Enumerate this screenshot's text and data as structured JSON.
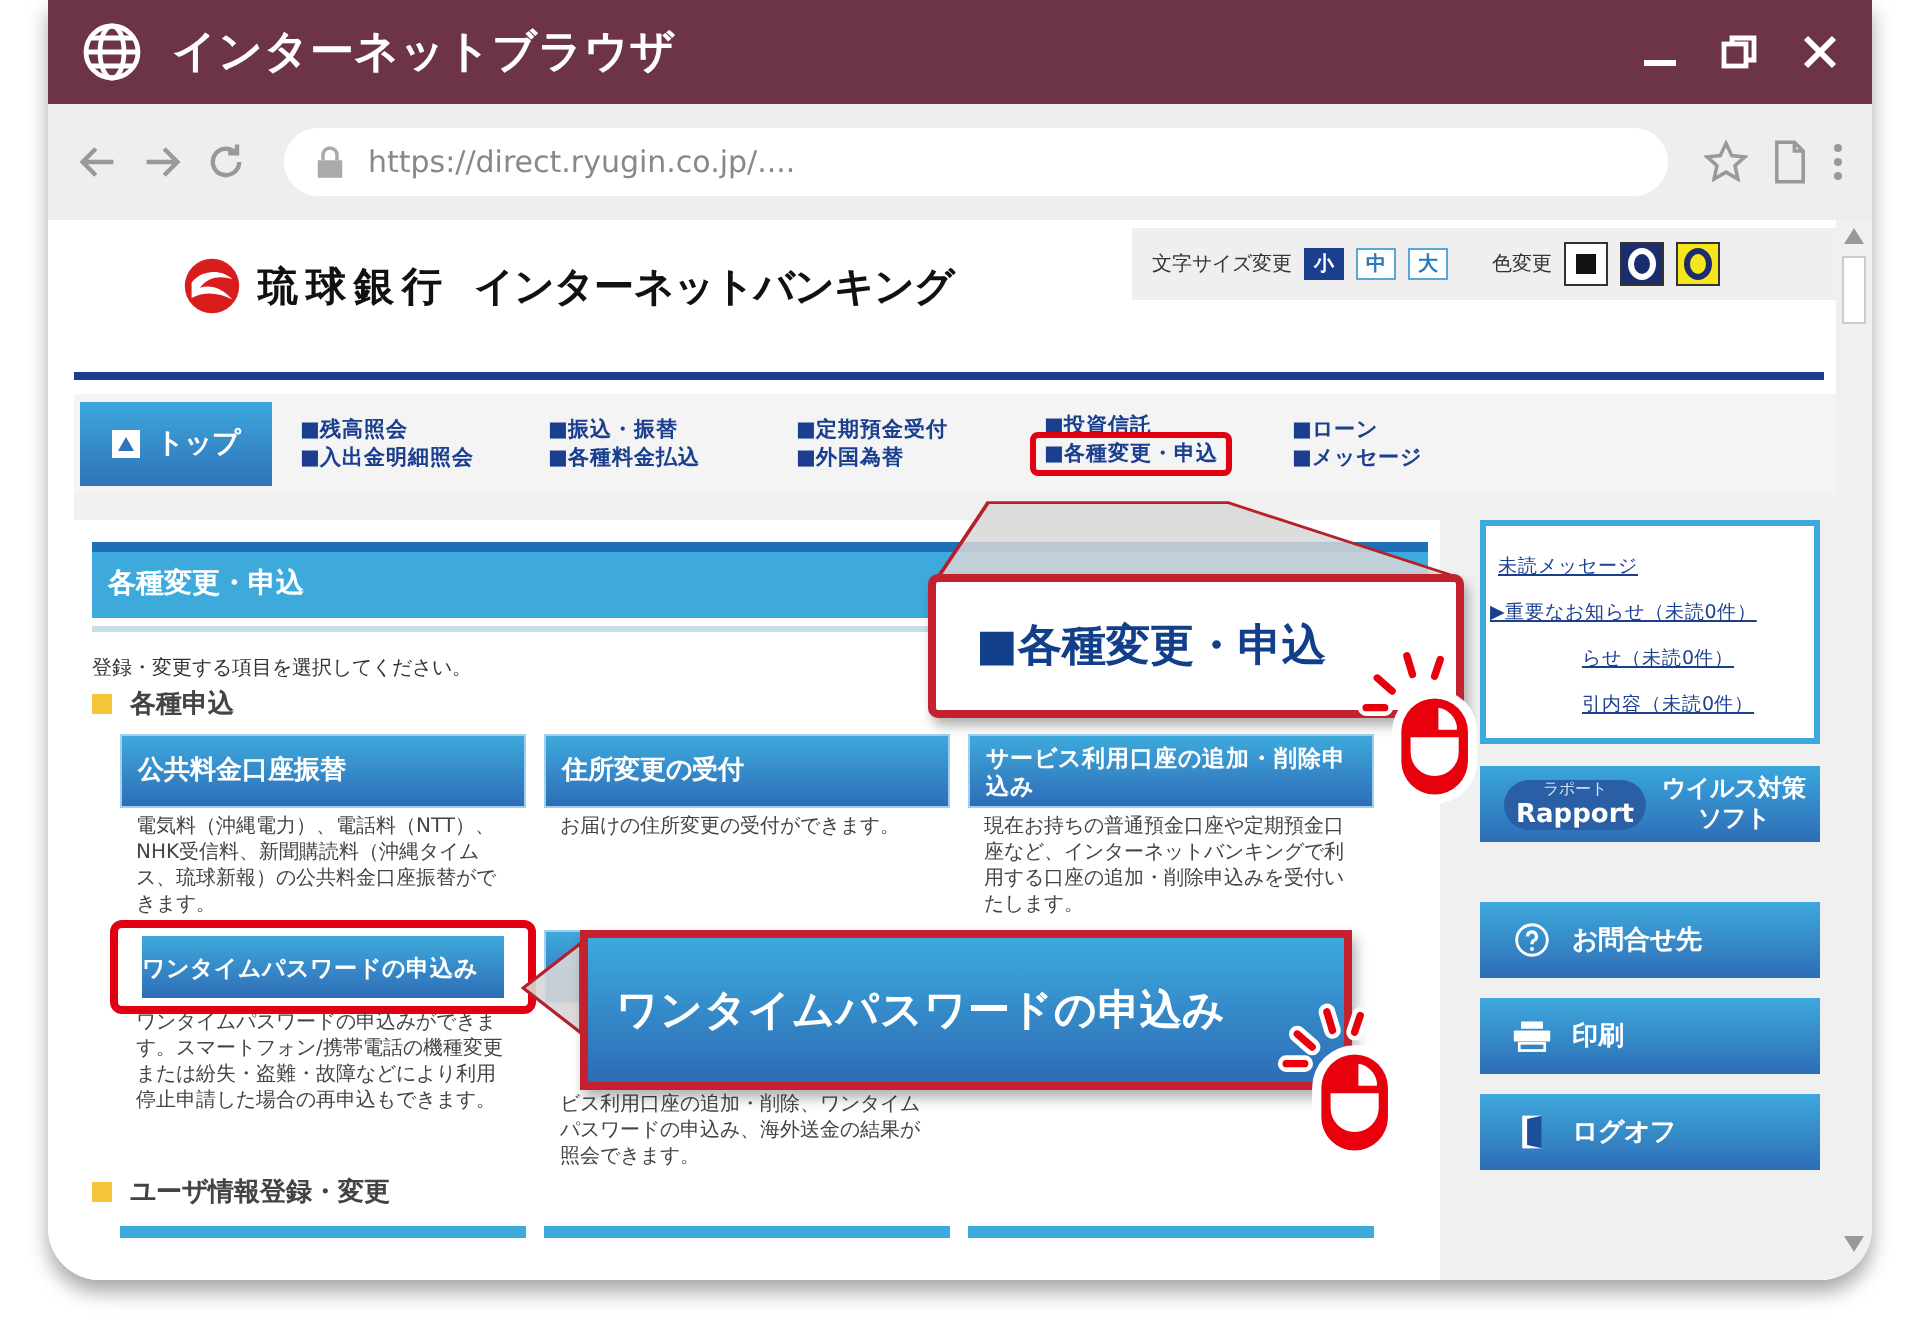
{
  "window": {
    "title": "インターネットブラウザ"
  },
  "address_bar": {
    "url": "https://direct.ryugin.co.jp/...."
  },
  "site": {
    "bank_name": "琉球銀行",
    "service_name": "インターネットバンキング"
  },
  "font_size": {
    "label": "文字サイズ変更",
    "options": [
      {
        "label": "小",
        "selected": true
      },
      {
        "label": "中",
        "selected": false
      },
      {
        "label": "大",
        "selected": false
      }
    ]
  },
  "color_change": {
    "label": "色変更",
    "options": [
      {
        "kind": "square",
        "color": "#ffffff"
      },
      {
        "kind": "ring",
        "color": "#1c2d6e"
      },
      {
        "kind": "ring",
        "color": "#f5e61e"
      }
    ]
  },
  "nav": {
    "top": "トップ",
    "columns": [
      {
        "links": [
          {
            "text": "■残高照会",
            "highlighted": false
          },
          {
            "text": "■入出金明細照会",
            "highlighted": false
          }
        ]
      },
      {
        "links": [
          {
            "text": "■振込・振替",
            "highlighted": false
          },
          {
            "text": "■各種料金払込",
            "highlighted": false
          }
        ]
      },
      {
        "links": [
          {
            "text": "■定期預金受付",
            "highlighted": false
          },
          {
            "text": "■外国為替",
            "highlighted": false
          }
        ]
      },
      {
        "links": [
          {
            "text": "■投資信託",
            "highlighted": false
          },
          {
            "text": "■各種変更・申込",
            "highlighted": true
          }
        ]
      },
      {
        "links": [
          {
            "text": "■ローン",
            "highlighted": false
          },
          {
            "text": "■メッセージ",
            "highlighted": false
          }
        ]
      }
    ]
  },
  "section": {
    "title": "各種変更・申込",
    "intro": "登録・変更する項目を選択してください。",
    "groups": [
      {
        "heading": "各種申込",
        "cards": [
          {
            "title": "公共料金口座振替",
            "description": "電気料（沖縄電力）、電話料（NTT）、NHK受信料、新聞購読料（沖縄タイムス、琉球新報）の公共料金口座振替ができます。",
            "highlighted": false
          },
          {
            "title": "住所変更の受付",
            "description": "お届けの住所変更の受付ができます。",
            "highlighted": false
          },
          {
            "title": "サービス利用口座の追加・削除申込み",
            "description": "現在お持ちの普通預金口座や定期預金口座など、インターネットバンキングで利用する口座の追加・削除申込みを受付いたします。",
            "highlighted": false
          },
          {
            "title": "ワンタイムパスワードの申込み",
            "description": "ワンタイムパスワードの申込みができます。スマートフォン/携帯電話の機種変更または紛失・盗難・故障などにより利用停止申請した場合の再申込もできます。",
            "highlighted": true
          },
          {
            "description": "ビス利用口座の追加・削除、ワンタイムパスワードの申込み、海外送金の結果が照会できます。",
            "highlighted": false
          }
        ]
      },
      {
        "heading": "ユーザ情報登録・変更"
      }
    ]
  },
  "sidebar": {
    "messages": {
      "title": "未読メッセージ",
      "items": [
        "▶重要なお知らせ（未読0件）",
        "らせ（未読0件）",
        "引内容（未読0件）"
      ]
    },
    "banner": {
      "caption": "ラポート",
      "name": "Rapport",
      "label": "ウイルス対策ソフト"
    },
    "buttons": [
      {
        "kind": "contact",
        "label": "お問合せ先"
      },
      {
        "kind": "print",
        "label": "印刷"
      },
      {
        "kind": "logoff",
        "label": "ログオフ"
      }
    ]
  },
  "callouts": [
    {
      "kind": "outline",
      "text": "■各種変更・申込"
    },
    {
      "kind": "filled",
      "text": "ワンタイムパスワードの申込み"
    }
  ]
}
